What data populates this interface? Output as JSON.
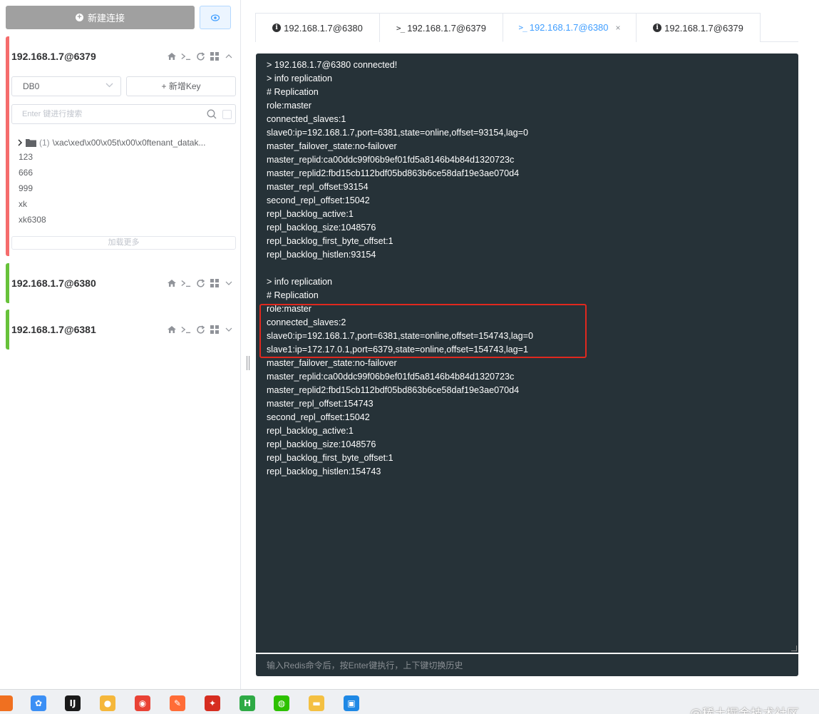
{
  "sidebar": {
    "new_connection_label": "新建连接",
    "connections": [
      {
        "title": "192.168.1.7@6379",
        "color": "#f56c6c",
        "expanded": true,
        "db_select": "DB0",
        "new_key_label": "+ 新增Key",
        "search_placeholder": "Enter 键进行搜索",
        "folder": {
          "count": "(1)",
          "name": "\\xac\\xed\\x00\\x05t\\x00\\x0ftenant_datak..."
        },
        "keys": [
          "123",
          "666",
          "999",
          "xk",
          "xk6308"
        ],
        "load_more_label": "加载更多"
      },
      {
        "title": "192.168.1.7@6380",
        "color": "#67c23a",
        "expanded": false
      },
      {
        "title": "192.168.1.7@6381",
        "color": "#67c23a",
        "expanded": false
      }
    ]
  },
  "tabs": [
    {
      "icon": "info-icon",
      "label": "192.168.1.7@6380",
      "active": false
    },
    {
      "icon": "terminal-icon",
      "label": "192.168.1.7@6379",
      "active": false
    },
    {
      "icon": "terminal-icon",
      "label": "192.168.1.7@6380",
      "active": true,
      "closable": true
    },
    {
      "icon": "info-icon",
      "label": "192.168.1.7@6379",
      "active": false
    }
  ],
  "console": {
    "lines": [
      "> 192.168.1.7@6380 connected!",
      "> info replication",
      "# Replication",
      "role:master",
      "connected_slaves:1",
      "slave0:ip=192.168.1.7,port=6381,state=online,offset=93154,lag=0",
      "master_failover_state:no-failover",
      "master_replid:ca00ddc99f06b9ef01fd5a8146b4b84d1320723c",
      "master_replid2:fbd15cb112bdf05bd863b6ce58daf19e3ae070d4",
      "master_repl_offset:93154",
      "second_repl_offset:15042",
      "repl_backlog_active:1",
      "repl_backlog_size:1048576",
      "repl_backlog_first_byte_offset:1",
      "repl_backlog_histlen:93154",
      "",
      "> info replication",
      "# Replication",
      "role:master",
      "connected_slaves:2",
      "slave0:ip=192.168.1.7,port=6381,state=online,offset=154743,lag=0",
      "slave1:ip=172.17.0.1,port=6379,state=online,offset=154743,lag=1",
      "master_failover_state:no-failover",
      "master_replid:ca00ddc99f06b9ef01fd5a8146b4b84d1320723c",
      "master_replid2:fbd15cb112bdf05bd863b6ce58daf19e3ae070d4",
      "master_repl_offset:154743",
      "second_repl_offset:15042",
      "repl_backlog_active:1",
      "repl_backlog_size:1048576",
      "repl_backlog_first_byte_offset:1",
      "repl_backlog_histlen:154743"
    ],
    "input_placeholder": "输入Redis命令后，按Enter键执行，上下键切换历史",
    "highlight_color": "#e0281e"
  },
  "taskbar": {
    "icons": [
      {
        "name": "app-orange-icon",
        "color": "#f07020",
        "glyph": ""
      },
      {
        "name": "baidu-netdisk-icon",
        "color": "#3b8ff5",
        "glyph": "✿"
      },
      {
        "name": "intellij-idea-icon",
        "color": "#1a1a1a",
        "glyph": "IJ"
      },
      {
        "name": "duck-app-icon",
        "color": "#f5b73b",
        "glyph": "●"
      },
      {
        "name": "chrome-icon",
        "color": "#e94235",
        "glyph": "◉"
      },
      {
        "name": "postman-icon",
        "color": "#ff6c37",
        "glyph": "✎"
      },
      {
        "name": "redis-manager-icon",
        "color": "#d62d20",
        "glyph": "✦"
      },
      {
        "name": "hbuilder-icon",
        "color": "#2eaa45",
        "glyph": "H"
      },
      {
        "name": "wechat-icon",
        "color": "#2dc100",
        "glyph": "◍"
      },
      {
        "name": "file-explorer-icon",
        "color": "#f4c042",
        "glyph": "▬"
      },
      {
        "name": "app-blue-orange-icon",
        "color": "#1e88e5",
        "glyph": "▣"
      }
    ],
    "watermark": "@稀土掘金技术社区"
  }
}
